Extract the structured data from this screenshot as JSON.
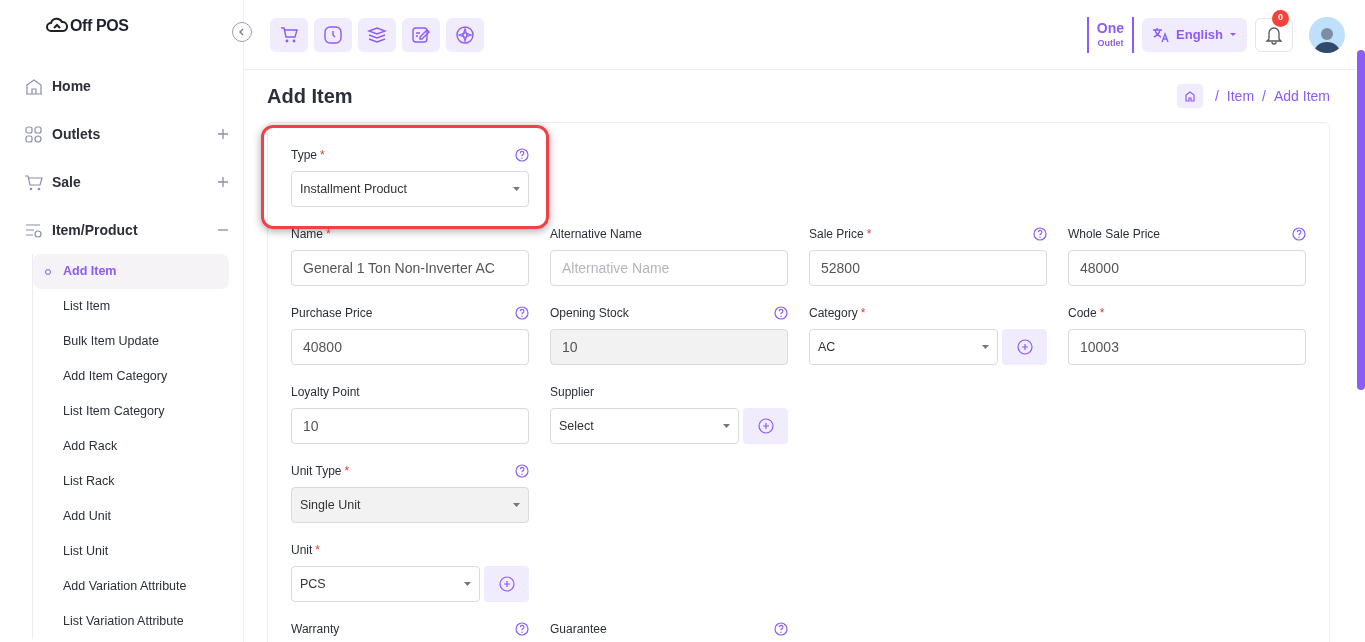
{
  "brand": {
    "name": "Off POS"
  },
  "sidebar": {
    "items": [
      {
        "label": "Home"
      },
      {
        "label": "Outlets",
        "expanded": false
      },
      {
        "label": "Sale",
        "expanded": false
      },
      {
        "label": "Item/Product",
        "expanded": true,
        "children": [
          {
            "label": "Add Item",
            "selected": true
          },
          {
            "label": "List Item",
            "selected": false
          },
          {
            "label": "Bulk Item Update",
            "selected": false
          },
          {
            "label": "Add Item Category",
            "selected": false
          },
          {
            "label": "List Item Category",
            "selected": false
          },
          {
            "label": "Add Rack",
            "selected": false
          },
          {
            "label": "List Rack",
            "selected": false
          },
          {
            "label": "Add Unit",
            "selected": false
          },
          {
            "label": "List Unit",
            "selected": false
          },
          {
            "label": "Add Variation Attribute",
            "selected": false
          },
          {
            "label": "List Variation Attribute",
            "selected": false
          }
        ]
      }
    ]
  },
  "header": {
    "outlet_count": "One",
    "outlet_label": "Outlet",
    "language": "English",
    "notification_count": "0"
  },
  "page": {
    "title": "Add Item",
    "breadcrumb_separator": "/",
    "breadcrumb": [
      "Item",
      "Add Item"
    ]
  },
  "form": {
    "required_marker": "*",
    "rows": [
      [
        {
          "label": "Type",
          "required": true,
          "help": true,
          "kind": "select",
          "value": "Installment Product",
          "disabled": false,
          "add_button": false,
          "highlighted": true
        }
      ],
      [
        {
          "label": "Name",
          "required": true,
          "help": false,
          "kind": "input",
          "value": "General 1 Ton Non-Inverter AC",
          "disabled": false,
          "add_button": false
        },
        {
          "label": "Alternative Name",
          "required": false,
          "help": false,
          "kind": "input",
          "placeholder": "Alternative Name",
          "disabled": false,
          "add_button": false
        },
        {
          "label": "Sale Price",
          "required": true,
          "help": true,
          "kind": "input",
          "value": "52800",
          "disabled": false,
          "add_button": false
        },
        {
          "label": "Whole Sale Price",
          "required": false,
          "help": true,
          "kind": "input",
          "value": "48000",
          "disabled": false,
          "add_button": false
        }
      ],
      [
        {
          "label": "Purchase Price",
          "required": false,
          "help": true,
          "kind": "input",
          "value": "40800",
          "disabled": false,
          "add_button": false
        },
        {
          "label": "Opening Stock",
          "required": false,
          "help": true,
          "kind": "input",
          "value": "10",
          "disabled": true,
          "add_button": false
        },
        {
          "label": "Category",
          "required": true,
          "help": false,
          "kind": "select",
          "value": "AC",
          "disabled": false,
          "add_button": true
        },
        {
          "label": "Code",
          "required": true,
          "help": false,
          "kind": "input",
          "value": "10003",
          "disabled": false,
          "add_button": false
        }
      ],
      [
        {
          "label": "Loyalty Point",
          "required": false,
          "help": false,
          "kind": "input",
          "value": "10",
          "disabled": false,
          "add_button": false
        },
        {
          "label": "Supplier",
          "required": false,
          "help": false,
          "kind": "select",
          "value": "Select",
          "disabled": false,
          "add_button": true
        }
      ],
      [
        {
          "label": "Unit Type",
          "required": true,
          "help": true,
          "kind": "select",
          "value": "Single Unit",
          "disabled": true,
          "add_button": false
        }
      ],
      [
        {
          "label": "Unit",
          "required": true,
          "help": false,
          "kind": "select",
          "value": "PCS",
          "disabled": false,
          "add_button": true
        }
      ],
      [
        {
          "label": "Warranty",
          "required": false,
          "help": true,
          "kind": "label"
        },
        {
          "label": "Guarantee",
          "required": false,
          "help": true,
          "kind": "label"
        }
      ]
    ]
  }
}
